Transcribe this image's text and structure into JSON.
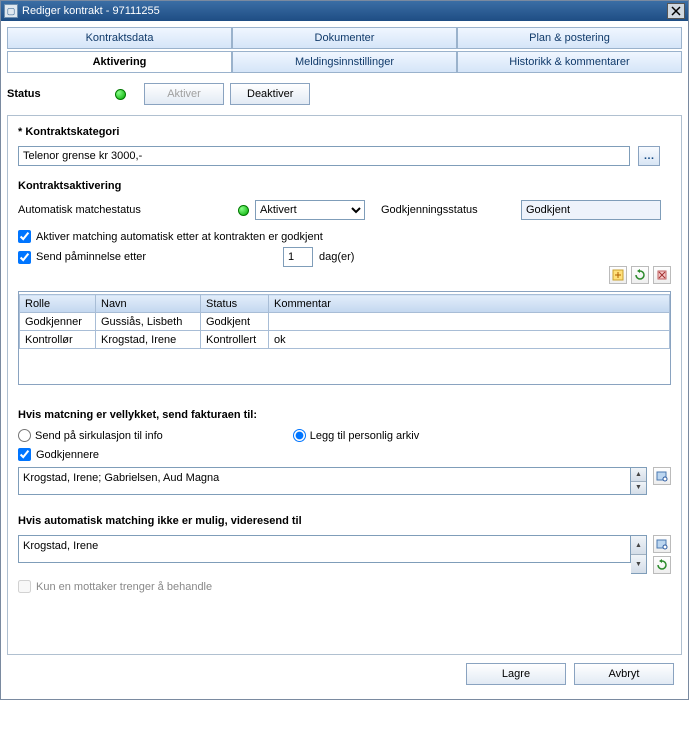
{
  "window": {
    "title": "Rediger kontrakt - 97111255"
  },
  "tabs": {
    "row1": [
      {
        "label": "Kontraktsdata",
        "active": false
      },
      {
        "label": "Dokumenter",
        "active": false
      },
      {
        "label": "Plan & postering",
        "active": false
      }
    ],
    "row2": [
      {
        "label": "Aktivering",
        "active": true
      },
      {
        "label": "Meldingsinnstillinger",
        "active": false
      },
      {
        "label": "Historikk & kommentarer",
        "active": false
      }
    ]
  },
  "status": {
    "label": "Status",
    "color": "#1ea31e",
    "aktiver": "Aktiver",
    "deaktiver": "Deaktiver"
  },
  "kategori": {
    "label": "* Kontraktskategori",
    "value": "Telenor grense kr 3000,-"
  },
  "aktivering": {
    "heading": "Kontraktsaktivering",
    "auto_label": "Automatisk matchestatus",
    "auto_value": "Aktivert",
    "godkj_label": "Godkjenningsstatus",
    "godkj_value": "Godkjent",
    "cb_auto": "Aktiver matching automatisk etter at kontrakten er godkjent",
    "cb_reminder_prefix": "Send påminnelse etter",
    "reminder_value": "1",
    "reminder_suffix": "dag(er)"
  },
  "table": {
    "headers": [
      "Rolle",
      "Navn",
      "Status",
      "Kommentar"
    ],
    "rows": [
      {
        "c0": "Godkjenner",
        "c1": "Gussiås, Lisbeth",
        "c2": "Godkjent",
        "c3": ""
      },
      {
        "c0": "Kontrollør",
        "c1": "Krogstad, Irene",
        "c2": "Kontrollert",
        "c3": "ok"
      }
    ]
  },
  "if_match": {
    "heading": "Hvis matcning er vellykket, send fakturaen til:",
    "radio1": "Send på sirkulasjon til info",
    "radio2": "Legg til personlig arkiv",
    "cb_godkj": "Godkjennere",
    "recipients": "Krogstad, Irene; Gabrielsen, Aud Magna"
  },
  "no_match": {
    "heading": "Hvis automatisk matching ikke er mulig, videresend til",
    "recipients": "Krogstad, Irene",
    "cb_single": "Kun en mottaker trenger å behandle"
  },
  "footer": {
    "save": "Lagre",
    "cancel": "Avbryt"
  }
}
